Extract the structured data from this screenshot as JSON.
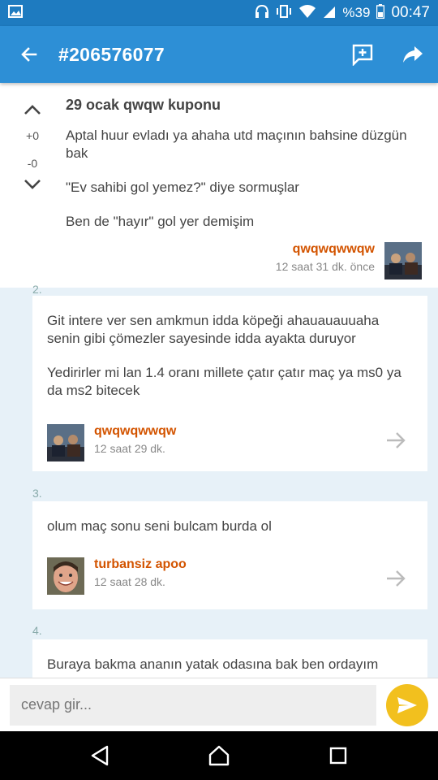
{
  "status_bar": {
    "battery": "%39",
    "time": "00:47"
  },
  "app_bar": {
    "title": "#206576077"
  },
  "post": {
    "title": "29 ocak qwqw kuponu",
    "votes_up": "+0",
    "votes_down": "-0",
    "lines": [
      "Aptal huur evladı ya ahaha utd maçının bahsine düzgün bak",
      "\"Ev sahibi gol yemez?\" diye sormuşlar",
      "Ben de \"hayır\" gol yer demişim"
    ],
    "author": "qwqwqwwqw",
    "time": "12 saat 31 dk. önce"
  },
  "replies": [
    {
      "number": "2.",
      "paragraphs": [
        "Git intere ver sen amkmun idda köpeği ahauauauuaha senin gibi çömezler sayesinde idda ayakta duruyor",
        "Yedirirler mi lan 1.4 oranı millete çatır çatır maç ya ms0 ya da ms2 bitecek"
      ],
      "author": "qwqwqwwqw",
      "time": "12 saat 29 dk."
    },
    {
      "number": "3.",
      "paragraphs": [
        "olum maç sonu seni bulcam burda ol"
      ],
      "author": "turbansiz apoo",
      "time": "12 saat 28 dk."
    },
    {
      "number": "4.",
      "paragraphs": [
        "Buraya bakma ananın yatak odasına bak ben ordayım"
      ]
    }
  ],
  "reply_bar": {
    "placeholder": "cevap gir..."
  },
  "colors": {
    "primary": "#2d8fd6",
    "status": "#1e7bc0",
    "author": "#d35400",
    "send": "#f2c01e"
  }
}
